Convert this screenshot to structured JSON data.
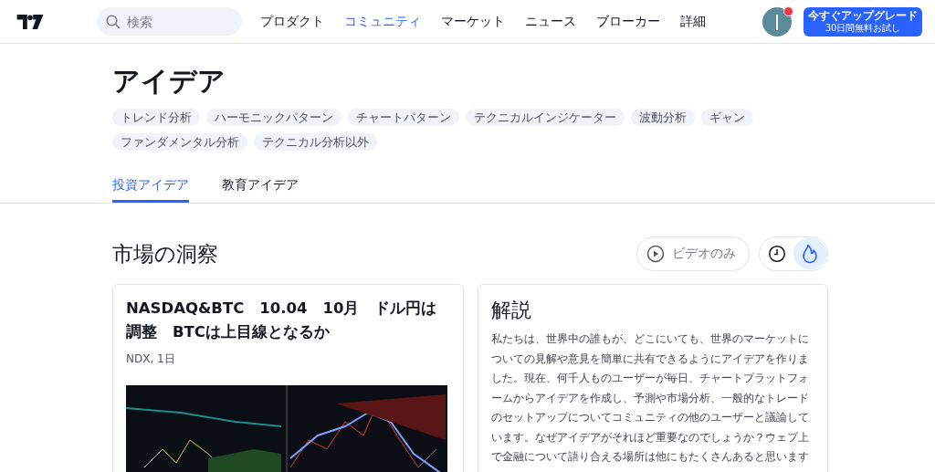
{
  "header": {
    "search": {
      "placeholder": "検索"
    },
    "nav": [
      {
        "label": "プロダクト",
        "selected": false
      },
      {
        "label": "コミュニティ",
        "selected": true
      },
      {
        "label": "マーケット",
        "selected": false
      },
      {
        "label": "ニュース",
        "selected": false
      },
      {
        "label": "ブローカー",
        "selected": false
      },
      {
        "label": "詳細",
        "selected": false
      }
    ],
    "notification": true,
    "upgrade": {
      "title": "今すぐアップグレード",
      "subtitle": "30日間無料お試し"
    }
  },
  "page": {
    "title": "アイデア",
    "tags": [
      "トレンド分析",
      "ハーモニックパターン",
      "チャートパターン",
      "テクニカルインジケーター",
      "波動分析",
      "ギャン",
      "ファンダメンタル分析",
      "テクニカル分析以外"
    ],
    "tabs": [
      {
        "label": "投資アイデア",
        "selected": true
      },
      {
        "label": "教育アイデア",
        "selected": false
      }
    ]
  },
  "section": {
    "title": "市場の洞察",
    "video_filter": {
      "label": "ビデオのみ",
      "on": false
    },
    "sort": [
      {
        "kind": "recent",
        "selected": false
      },
      {
        "kind": "popular",
        "selected": true
      }
    ]
  },
  "idea_card": {
    "title": "NASDAQ&BTC　10.04　10月　ドル円は調整　BTCは上目線となるか",
    "meta": "NDX, 1日"
  },
  "about_card": {
    "title": "解説",
    "text": "私たちは、世界中の誰もが、どこにいても、世界のマーケットについての見解や意見を簡単に共有できるようにアイデアを作りました。現在、何千人ものユーザーが毎日、チャートプラットフォームからアイデアを作成し、予測や市場分析、一般的なトレードのセットアップについてコミュニティの他のユーザーと議論しています。なぜアイデアがそれほど重要なのでしょうか？ウェブ上で金融について語り合える場所は他にもたくさんあると思います"
  }
}
